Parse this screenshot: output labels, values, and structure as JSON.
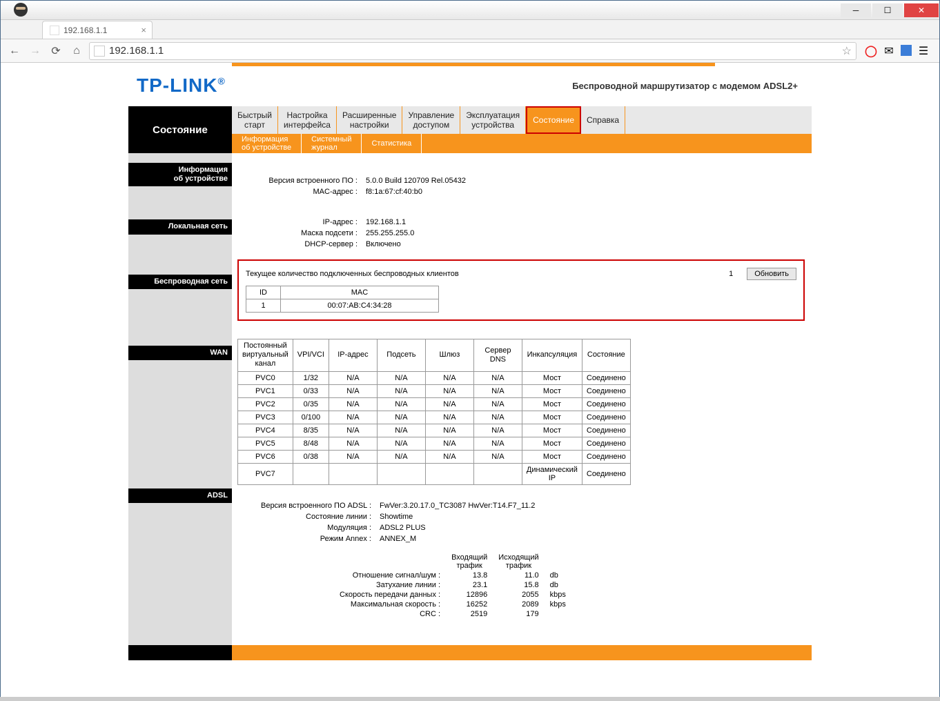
{
  "browser": {
    "tab_title": "192.168.1.1",
    "url": "192.168.1.1"
  },
  "header": {
    "logo": "TP-LINK",
    "reg": "®",
    "description": "Беспроводной маршрутизатор с модемом ADSL2+"
  },
  "nav": {
    "title": "Состояние",
    "main": [
      {
        "l1": "Быстрый",
        "l2": "старт"
      },
      {
        "l1": "Настройка",
        "l2": "интерфейса"
      },
      {
        "l1": "Расширенные",
        "l2": "настройки"
      },
      {
        "l1": "Управление",
        "l2": "доступом"
      },
      {
        "l1": "Эксплуатация",
        "l2": "устройства"
      },
      {
        "l1": "Состояние",
        "l2": "",
        "active": true
      },
      {
        "l1": "Справка",
        "l2": ""
      }
    ],
    "sub": [
      {
        "l1": "Информация",
        "l2": "об устройстве"
      },
      {
        "l1": "Системный",
        "l2": "журнал"
      },
      {
        "l1": "Статистика",
        "l2": ""
      }
    ]
  },
  "sections": {
    "device": {
      "l1": "Информация",
      "l2": "об устройстве"
    },
    "lan": "Локальная сеть",
    "wlan": "Беспроводная сеть",
    "wan": "WAN",
    "adsl": "ADSL"
  },
  "device": {
    "fw_label": "Версия встроенного ПО :",
    "fw_value": "5.0.0 Build 120709 Rel.05432",
    "mac_label": "MAC-адрес :",
    "mac_value": "f8:1a:67:cf:40:b0"
  },
  "lan": {
    "ip_label": "IP-адрес :",
    "ip_value": "192.168.1.1",
    "mask_label": "Маска подсети :",
    "mask_value": "255.255.255.0",
    "dhcp_label": "DHCP-сервер :",
    "dhcp_value": "Включено"
  },
  "wlan": {
    "label": "Текущее количество подключенных беспроводных клиентов",
    "count": "1",
    "refresh": "Обновить",
    "th_id": "ID",
    "th_mac": "MAC",
    "rows": [
      {
        "id": "1",
        "mac": "00:07:AB:C4:34:28"
      }
    ]
  },
  "wan": {
    "headers": {
      "pvc": "Постоянный виртуальный канал",
      "vpi": "VPI/VCI",
      "ip": "IP-адрес",
      "subnet": "Подсеть",
      "gw": "Шлюз",
      "dns": "Сервер DNS",
      "encap": "Инкапсуляция",
      "state": "Состояние"
    },
    "rows": [
      {
        "pvc": "PVC0",
        "vpi": "1/32",
        "ip": "N/A",
        "subnet": "N/A",
        "gw": "N/A",
        "dns": "N/A",
        "encap": "Мост",
        "state": "Соединено"
      },
      {
        "pvc": "PVC1",
        "vpi": "0/33",
        "ip": "N/A",
        "subnet": "N/A",
        "gw": "N/A",
        "dns": "N/A",
        "encap": "Мост",
        "state": "Соединено"
      },
      {
        "pvc": "PVC2",
        "vpi": "0/35",
        "ip": "N/A",
        "subnet": "N/A",
        "gw": "N/A",
        "dns": "N/A",
        "encap": "Мост",
        "state": "Соединено"
      },
      {
        "pvc": "PVC3",
        "vpi": "0/100",
        "ip": "N/A",
        "subnet": "N/A",
        "gw": "N/A",
        "dns": "N/A",
        "encap": "Мост",
        "state": "Соединено"
      },
      {
        "pvc": "PVC4",
        "vpi": "8/35",
        "ip": "N/A",
        "subnet": "N/A",
        "gw": "N/A",
        "dns": "N/A",
        "encap": "Мост",
        "state": "Соединено"
      },
      {
        "pvc": "PVC5",
        "vpi": "8/48",
        "ip": "N/A",
        "subnet": "N/A",
        "gw": "N/A",
        "dns": "N/A",
        "encap": "Мост",
        "state": "Соединено"
      },
      {
        "pvc": "PVC6",
        "vpi": "0/38",
        "ip": "N/A",
        "subnet": "N/A",
        "gw": "N/A",
        "dns": "N/A",
        "encap": "Мост",
        "state": "Соединено"
      },
      {
        "pvc": "PVC7",
        "vpi": "",
        "ip": "",
        "subnet": "",
        "gw": "",
        "dns": "",
        "encap": "Динамический IP",
        "state": "Соединено",
        "blur": true
      }
    ]
  },
  "adsl": {
    "fw_label": "Версия встроенного ПО ADSL :",
    "fw_value": "FwVer:3.20.17.0_TC3087 HwVer:T14.F7_11.2",
    "line_label": "Состояние линии :",
    "line_value": "Showtime",
    "mod_label": "Модуляция :",
    "mod_value": "ADSL2 PLUS",
    "annex_label": "Режим Annex :",
    "annex_value": "ANNEX_M",
    "stats": {
      "down_hdr_l1": "Входящий",
      "down_hdr_l2": "трафик",
      "up_hdr_l1": "Исходящий",
      "up_hdr_l2": "трафик",
      "snr_label": "Отношение сигнал/шум :",
      "snr_down": "13.8",
      "snr_up": "11.0",
      "snr_unit": "db",
      "att_label": "Затухание линии :",
      "att_down": "23.1",
      "att_up": "15.8",
      "att_unit": "db",
      "rate_label": "Скорость передачи данных :",
      "rate_down": "12896",
      "rate_up": "2055",
      "rate_unit": "kbps",
      "max_label": "Максимальная скорость :",
      "max_down": "16252",
      "max_up": "2089",
      "max_unit": "kbps",
      "crc_label": "CRC :",
      "crc_down": "2519",
      "crc_up": "179"
    }
  }
}
